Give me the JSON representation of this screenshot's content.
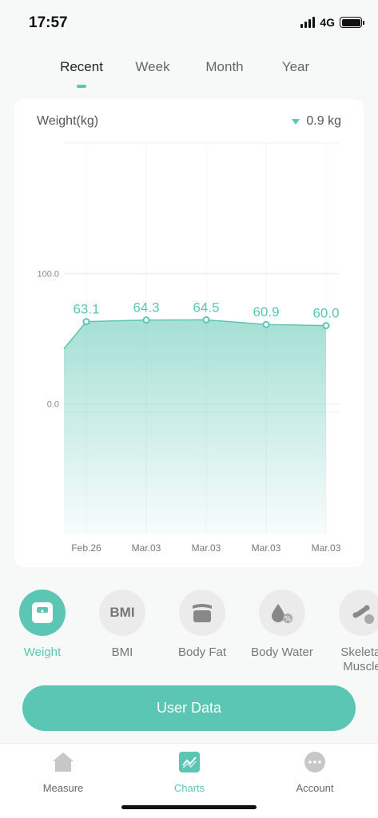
{
  "status_bar": {
    "time": "17:57",
    "network": "4G"
  },
  "tabs": [
    {
      "label": "Recent",
      "active": true
    },
    {
      "label": "Week",
      "active": false
    },
    {
      "label": "Month",
      "active": false
    },
    {
      "label": "Year",
      "active": false
    }
  ],
  "card": {
    "title": "Weight(kg)",
    "change_icon": "triangle-down-icon",
    "change_value": "0.9 kg"
  },
  "chart_data": {
    "type": "area",
    "categories": [
      "Feb.26",
      "Mar.03",
      "Mar.03",
      "Mar.03",
      "Mar.03"
    ],
    "values": [
      63.1,
      64.3,
      64.5,
      60.9,
      60.0
    ],
    "data_labels": [
      "63.1",
      "64.3",
      "64.5",
      "60.9",
      "60.0"
    ],
    "y_ticks": [
      "100.0",
      "0.0"
    ],
    "ylim": [
      -100,
      200
    ],
    "grid": true,
    "color": "#5bc6b3"
  },
  "metrics": [
    {
      "label": "Weight",
      "icon": "scale-icon",
      "active": true
    },
    {
      "label": "BMI",
      "icon": "bmi-icon",
      "active": false
    },
    {
      "label": "Body Fat",
      "icon": "body-fat-icon",
      "active": false
    },
    {
      "label": "Body Water",
      "icon": "water-drop-icon",
      "active": false
    },
    {
      "label": "Skeletal Muscle",
      "icon": "bone-icon",
      "active": false
    }
  ],
  "user_data_button": "User Data",
  "bottom_nav": [
    {
      "label": "Measure",
      "icon": "home-icon",
      "active": false
    },
    {
      "label": "Charts",
      "icon": "chart-icon",
      "active": true
    },
    {
      "label": "Account",
      "icon": "account-icon",
      "active": false
    }
  ],
  "colors": {
    "accent": "#5bc6b3",
    "inactive_circle": "#ebebeb"
  }
}
